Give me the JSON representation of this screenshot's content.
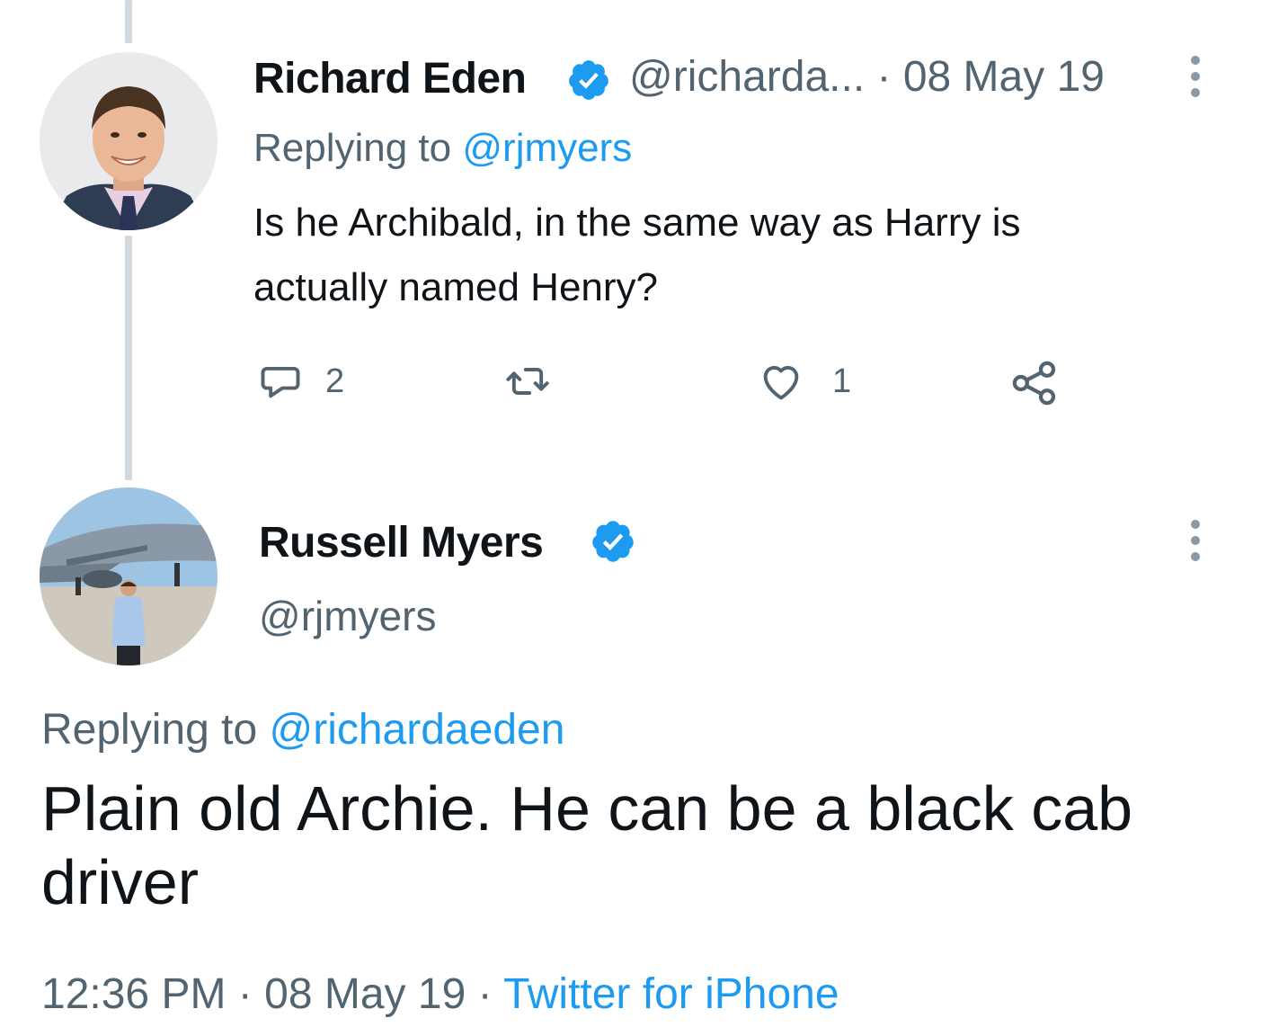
{
  "reply_tweet": {
    "display_name": "Richard Eden",
    "handle": "@richarda...",
    "separator": "·",
    "date": "08 May 19",
    "replying_prefix": "Replying to",
    "replying_handle": "@rjmyers",
    "text_line1": "Is he Archibald, in the same way as Harry is",
    "text_line2": "actually named Henry?",
    "actions": {
      "reply_count": "2",
      "retweet_count": "",
      "like_count": "1"
    },
    "icons": [
      "reply-icon",
      "retweet-icon",
      "heart-icon",
      "share-icon",
      "more-icon",
      "verified-icon"
    ]
  },
  "main_tweet": {
    "display_name": "Russell Myers",
    "handle": "@rjmyers",
    "replying_prefix": "Replying to",
    "replying_handle": "@richardaeden",
    "text": "Plain old Archie. He can be a black cab driver",
    "time": "12:36 PM",
    "separator1": "·",
    "date": "08 May 19",
    "separator2": "·",
    "source": "Twitter for iPhone"
  },
  "colors": {
    "link_blue": "#1d9bf0",
    "secondary_text": "#536471",
    "primary_text": "#0f1419",
    "thread_line": "#cfd9de"
  }
}
